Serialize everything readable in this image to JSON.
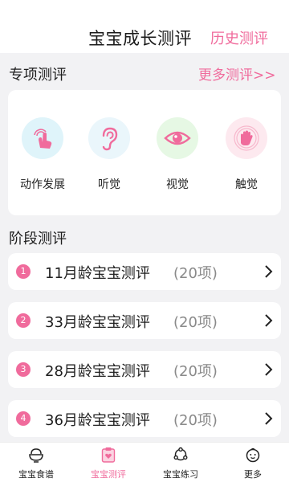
{
  "header": {
    "title": "宝宝成长测评",
    "history_link": "历史测评"
  },
  "special": {
    "section_title": "专项测评",
    "more_link": "更多测评>>",
    "items": [
      {
        "label": "动作发展",
        "icon": "hand-tap-icon",
        "bg": "#dff4fa",
        "color": "#f06b9c"
      },
      {
        "label": "听觉",
        "icon": "ear-icon",
        "bg": "#eaf6fb",
        "color": "#f06b9c"
      },
      {
        "label": "视觉",
        "icon": "eye-icon",
        "bg": "#e6f8e4",
        "color": "#f06b9c"
      },
      {
        "label": "触觉",
        "icon": "palm-icon",
        "bg": "#fde9ef",
        "color": "#f06b9c"
      }
    ]
  },
  "stage": {
    "section_title": "阶段测评",
    "rows": [
      {
        "num": "1",
        "title": "11月龄宝宝测评",
        "count": "(20项)"
      },
      {
        "num": "2",
        "title": "33月龄宝宝测评",
        "count": "(20项)"
      },
      {
        "num": "3",
        "title": "28月龄宝宝测评",
        "count": "(20项)"
      },
      {
        "num": "4",
        "title": "36月龄宝宝测评",
        "count": "(20项)"
      }
    ]
  },
  "tabbar": {
    "active_color": "#f06b9c",
    "tabs": [
      {
        "label": "宝宝食谱",
        "icon": "bowl-icon"
      },
      {
        "label": "宝宝测评",
        "icon": "clipboard-heart-icon",
        "active": true
      },
      {
        "label": "宝宝练习",
        "icon": "exercise-ring-icon"
      },
      {
        "label": "更多",
        "icon": "baby-face-icon"
      }
    ]
  }
}
